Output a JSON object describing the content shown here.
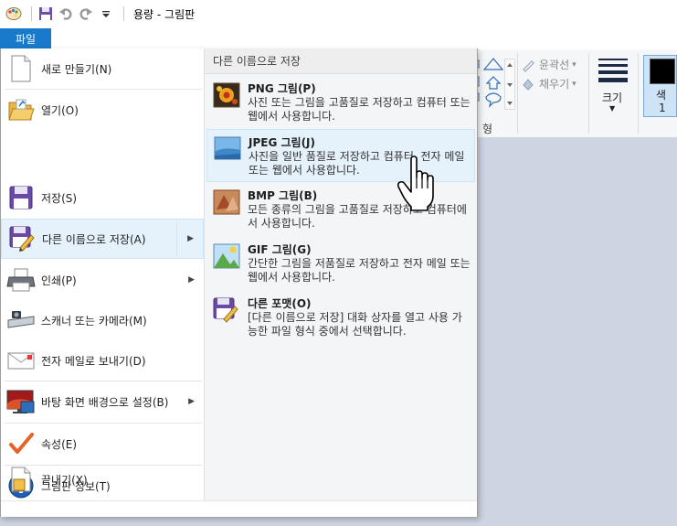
{
  "window": {
    "title": "용량 - 그림판"
  },
  "quick_access": {
    "save": "save-icon",
    "undo": "undo-icon",
    "redo": "redo-icon",
    "customize": "dropdown-icon"
  },
  "ribbon": {
    "file_tab": "파일",
    "outline_label": "윤곽선",
    "fill_label": "채우기",
    "size_label": "크기",
    "shapes_group_label": "형",
    "color_label_1": "색",
    "color_label_2": "1"
  },
  "menu": {
    "items": [
      {
        "label": "새로 만들기(N)",
        "icon": "new-file-icon"
      },
      {
        "label": "열기(O)",
        "icon": "open-folder-icon"
      },
      {
        "label": "저장(S)",
        "icon": "save-icon"
      },
      {
        "label": "다른 이름으로 저장(A)",
        "icon": "save-as-icon"
      },
      {
        "label": "인쇄(P)",
        "icon": "printer-icon"
      },
      {
        "label": "스캐너 또는 카메라(M)",
        "icon": "scanner-icon"
      },
      {
        "label": "전자 메일로 보내기(D)",
        "icon": "email-icon"
      },
      {
        "label": "바탕 화면 배경으로 설정(B)",
        "icon": "desktop-background-icon"
      },
      {
        "label": "속성(E)",
        "icon": "checkmark-icon"
      },
      {
        "label": "그림판 정보(T)",
        "icon": "info-icon"
      },
      {
        "label": "끝내기(X)",
        "icon": "exit-icon"
      }
    ],
    "submenu": {
      "header": "다른 이름으로 저장",
      "items": [
        {
          "title": "PNG 그림(P)",
          "desc": "사진 또는 그림을 고품질로 저장하고 컴퓨터 또는 웹에서 사용합니다.",
          "icon": "png-image-icon"
        },
        {
          "title": "JPEG 그림(J)",
          "desc": "사진을 일반 품질로 저장하고 컴퓨터, 전자 메일 또는 웹에서 사용합니다.",
          "icon": "jpeg-image-icon"
        },
        {
          "title": "BMP 그림(B)",
          "desc": "모든 종류의 그림을 고품질로 저장하고 컴퓨터에서 사용합니다.",
          "icon": "bmp-image-icon"
        },
        {
          "title": "GIF 그림(G)",
          "desc": "간단한 그림을 저품질로 저장하고 전자 메일 또는 웹에서 사용합니다.",
          "icon": "gif-image-icon"
        },
        {
          "title": "다른 포맷(O)",
          "desc": "[다른 이름으로 저장] 대화 상자를 열고 사용 가능한 파일 형식 중에서 선택합니다.",
          "icon": "other-format-icon"
        }
      ]
    }
  }
}
